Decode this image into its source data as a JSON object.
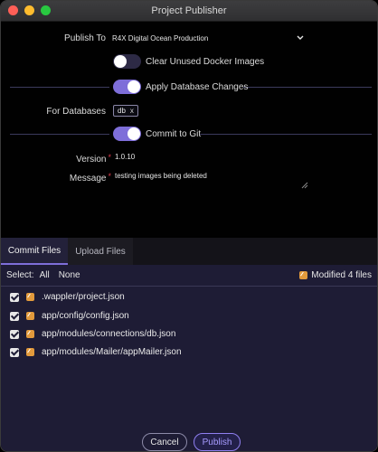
{
  "window": {
    "title": "Project Publisher"
  },
  "form": {
    "publish_to_label": "Publish To",
    "publish_to_value": "R4X Digital Ocean Production",
    "clear_images_label": "Clear Unused Docker Images",
    "clear_images_on": false,
    "apply_db_label": "Apply Database Changes",
    "apply_db_on": true,
    "for_databases_label": "For Databases",
    "db_chip": "db",
    "db_chip_remove": "x",
    "commit_git_label": "Commit to Git",
    "commit_git_on": true,
    "version_label": "Version",
    "version_value": "1.0.10",
    "message_label": "Message",
    "message_value": "testing images being deleted",
    "required_mark": "*"
  },
  "tabs": [
    {
      "label": "Commit Files",
      "active": true
    },
    {
      "label": "Upload Files",
      "active": false
    }
  ],
  "select": {
    "prefix": "Select:",
    "all": "All",
    "none": "None",
    "modified_label": "Modified 4 files"
  },
  "files": [
    {
      "path": ".wappler/project.json",
      "checked": true
    },
    {
      "path": "app/config/config.json",
      "checked": true
    },
    {
      "path": "app/modules/connections/db.json",
      "checked": true
    },
    {
      "path": "app/modules/Mailer/appMailer.json",
      "checked": true
    }
  ],
  "buttons": {
    "cancel": "Cancel",
    "publish": "Publish"
  },
  "colors": {
    "accent": "#7e6ed9",
    "panel": "#1e1c35",
    "file_icon": "#e29a3c",
    "required": "#e0394c"
  }
}
